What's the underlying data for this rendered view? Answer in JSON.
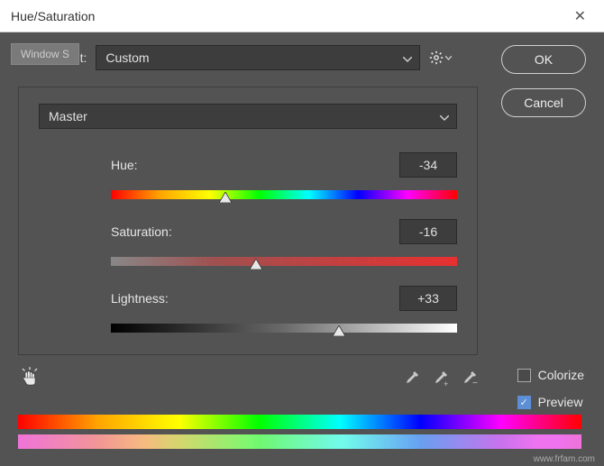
{
  "title": "Hue/Saturation",
  "background_window": "Window S",
  "preset": {
    "label": "Preset:",
    "value": "Custom"
  },
  "channel": {
    "value": "Master"
  },
  "sliders": {
    "hue": {
      "label": "Hue:",
      "value": "-34",
      "pos_pct": 33
    },
    "saturation": {
      "label": "Saturation:",
      "value": "-16",
      "pos_pct": 42
    },
    "lightness": {
      "label": "Lightness:",
      "value": "+33",
      "pos_pct": 66
    }
  },
  "buttons": {
    "ok": "OK",
    "cancel": "Cancel"
  },
  "checks": {
    "colorize": {
      "label": "Colorize",
      "checked": false
    },
    "preview": {
      "label": "Preview",
      "checked": true
    }
  },
  "watermark": "www.frfam.com"
}
